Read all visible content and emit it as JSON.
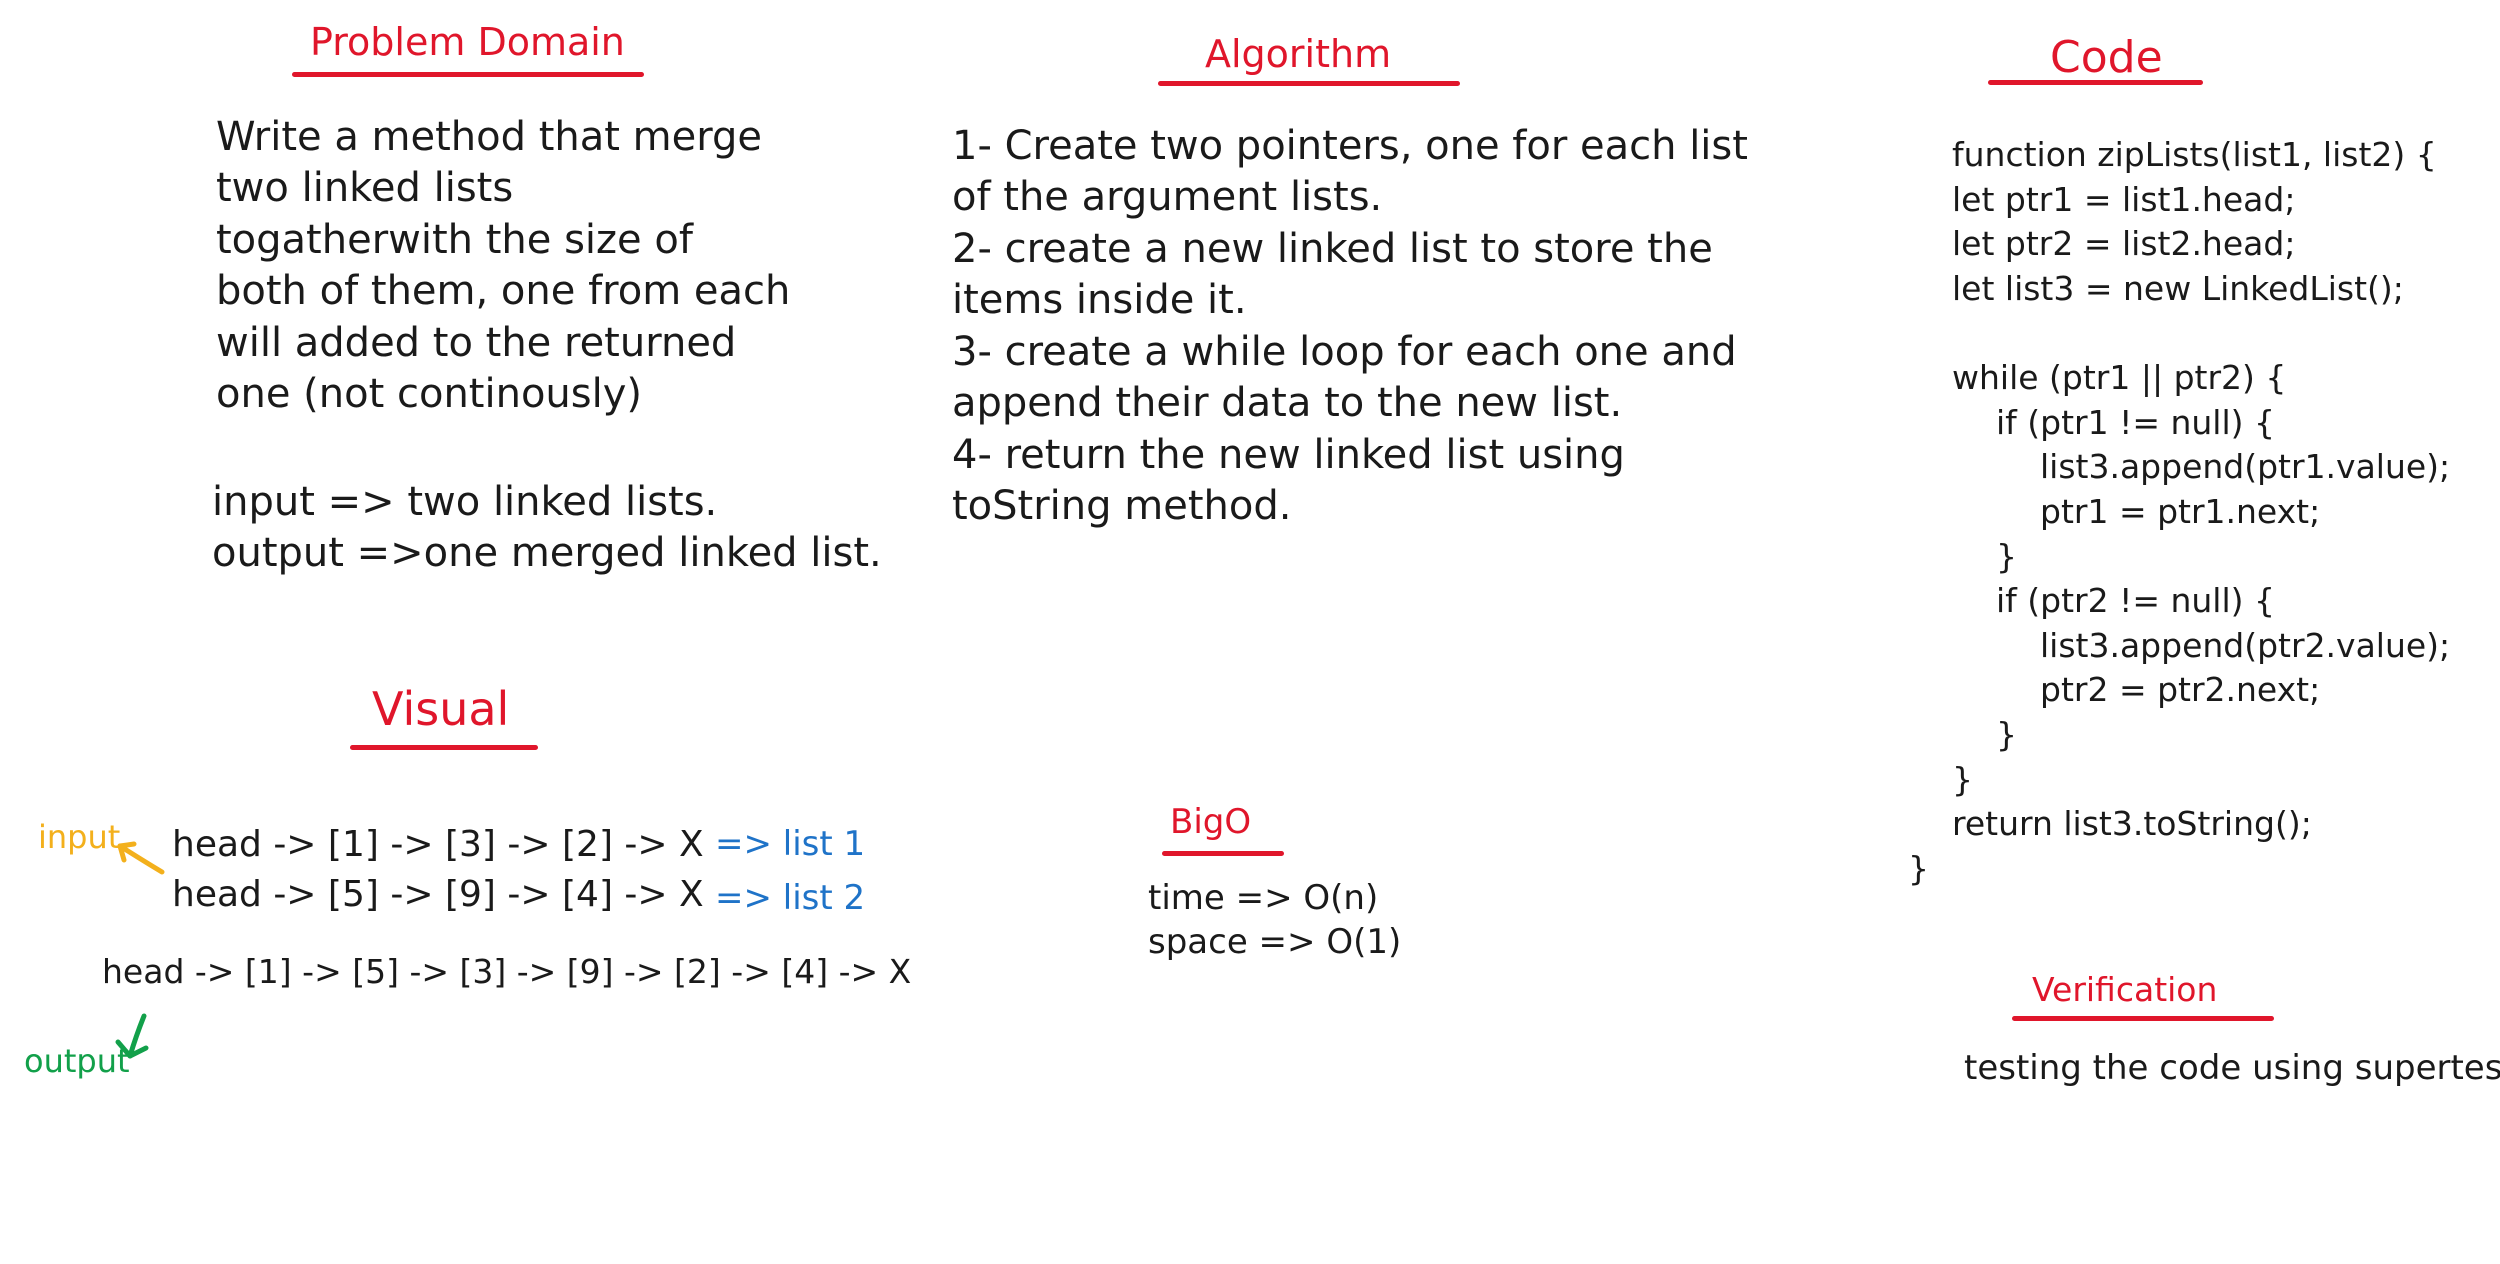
{
  "sections": {
    "problem_domain": {
      "heading": "Problem Domain",
      "lines": [
        "Write a method that merge",
        "two linked lists",
        "togatherwith the size of",
        "both of them, one from each",
        "will added to the returned",
        "one (not continously)"
      ],
      "io": [
        "input => two linked lists.",
        "output =>one merged linked list."
      ]
    },
    "algorithm": {
      "heading": "Algorithm",
      "lines": [
        "1- Create two pointers, one for each list",
        "of the argument lists.",
        "2- create a new linked list to store the",
        "items inside it.",
        "3- create a while loop for each one and",
        "append their data to the new list.",
        "4- return the new linked list using",
        "toString method."
      ]
    },
    "code": {
      "heading": "Code",
      "lines": [
        "function zipLists(list1, list2) {",
        "let ptr1 = list1.head;",
        "let ptr2 = list2.head;",
        "let list3 = new LinkedList();",
        "",
        "while (ptr1 || ptr2) {",
        "if (ptr1 != null) {",
        "list3.append(ptr1.value);",
        "ptr1 = ptr1.next;",
        "}",
        "if (ptr2 != null) {",
        "list3.append(ptr2.value);",
        "ptr2 = ptr2.next;",
        "}",
        "}",
        "return list3.toString();",
        "}"
      ]
    },
    "visual": {
      "heading": "Visual",
      "input_label": "input",
      "list1": "head -> [1] -> [3] -> [2] -> X",
      "list1_label": "=> list 1",
      "list2": "head -> [5] -> [9] -> [4] -> X",
      "list2_label": "=> list 2",
      "merged": "head -> [1] -> [5] -> [3] -> [9] -> [2] -> [4] -> X",
      "output_label": "output"
    },
    "bigo": {
      "heading": "BigO",
      "time": "time => O(n)",
      "space": "space => O(1)"
    },
    "verification": {
      "heading": "Verification",
      "text": "testing the code using supertest"
    }
  },
  "colors": {
    "heading": "#e0162b",
    "input_label": "#f3b01c",
    "list_label": "#1f73c8",
    "output_label": "#12a04a"
  }
}
